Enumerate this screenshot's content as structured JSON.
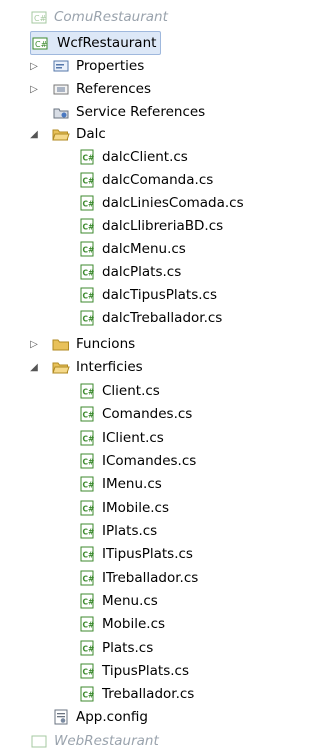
{
  "tree": {
    "top_partial_project": "ComuRestaurant",
    "project": "WcfRestaurant",
    "items": [
      {
        "label": "Properties",
        "icon": "properties-icon"
      },
      {
        "label": "References",
        "icon": "references-icon"
      },
      {
        "label": "Service References",
        "icon": "service-references-icon"
      },
      {
        "label": "Dalc",
        "icon": "folder-open-icon"
      }
    ],
    "dalc_files": [
      "dalcClient.cs",
      "dalcComanda.cs",
      "dalcLiniesComada.cs",
      "dalcLlibreriaBD.cs",
      "dalcMenu.cs",
      "dalcPlats.cs",
      "dalcTipusPlats.cs",
      "dalcTreballador.cs"
    ],
    "folder_funcions": "Funcions",
    "folder_interficies": "Interficies",
    "interficies_files": [
      "Client.cs",
      "Comandes.cs",
      "IClient.cs",
      "IComandes.cs",
      "IMenu.cs",
      "IMobile.cs",
      "IPlats.cs",
      "ITipusPlats.cs",
      "ITreballador.cs",
      "Menu.cs",
      "Mobile.cs",
      "Plats.cs",
      "TipusPlats.cs",
      "Treballador.cs"
    ],
    "app_config": "App.config",
    "bottom_partial_project": "WebRestaurant"
  },
  "colors": {
    "selection_bg": "#dde8f7",
    "folder": "#e8c15a",
    "cs_green": "#3c8a2e"
  }
}
